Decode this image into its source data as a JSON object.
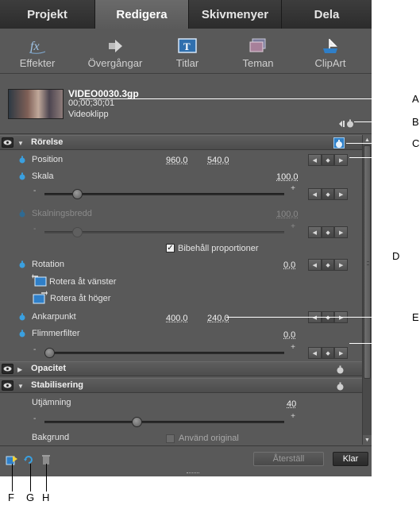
{
  "tabs": [
    {
      "label": "Projekt",
      "active": false
    },
    {
      "label": "Redigera",
      "active": true
    },
    {
      "label": "Skivmenyer",
      "active": false
    },
    {
      "label": "Dela",
      "active": false
    }
  ],
  "toolbar": [
    {
      "label": "Effekter",
      "icon": "fx-icon"
    },
    {
      "label": "Övergångar",
      "icon": "transition-arrow-icon"
    },
    {
      "label": "Titlar",
      "icon": "title-icon"
    },
    {
      "label": "Teman",
      "icon": "theme-icon"
    },
    {
      "label": "ClipArt",
      "icon": "clipart-icon"
    }
  ],
  "clip": {
    "name": "VIDEO0030.3gp",
    "duration": "00;00;30;01",
    "type": "Videoklipp"
  },
  "sections": {
    "motion": {
      "label": "Rörelse",
      "expanded": true
    },
    "opacity": {
      "label": "Opacitet",
      "expanded": false
    },
    "stabilization": {
      "label": "Stabilisering",
      "expanded": true
    }
  },
  "properties": {
    "position": {
      "label": "Position",
      "x": "960,0",
      "y": "540,0"
    },
    "scale": {
      "label": "Skala",
      "value": "100,0",
      "slider_fraction": 0.12
    },
    "scale_width": {
      "label": "Skalningsbredd",
      "value": "100,0",
      "slider_fraction": 0.12,
      "disabled": true
    },
    "keep_proportions": {
      "label": "Bibehåll proportioner",
      "checked": true
    },
    "rotation": {
      "label": "Rotation",
      "value": "0,0"
    },
    "rotate_left": {
      "label": "Rotera åt vänster"
    },
    "rotate_right": {
      "label": "Rotera åt höger"
    },
    "anchor": {
      "label": "Ankarpunkt",
      "x": "400,0",
      "y": "240,0"
    },
    "flicker": {
      "label": "Flimmerfilter",
      "value": "0,0",
      "slider_fraction": 0.0
    },
    "smoothing": {
      "label": "Utjämning",
      "value": "40",
      "slider_fraction": 0.38
    },
    "background": {
      "label": "Bakgrund",
      "checkbox_label": "Använd original",
      "checked": false
    }
  },
  "footer": {
    "reset_label": "Återställ",
    "done_label": "Klar"
  },
  "callouts": {
    "A": "A",
    "B": "B",
    "C": "C",
    "D": "D",
    "E": "E",
    "F": "F",
    "G": "G",
    "H": "H"
  },
  "colors": {
    "panel": "#595959",
    "accent_icon": "#3aa0e0",
    "tab_active": "#666666"
  }
}
